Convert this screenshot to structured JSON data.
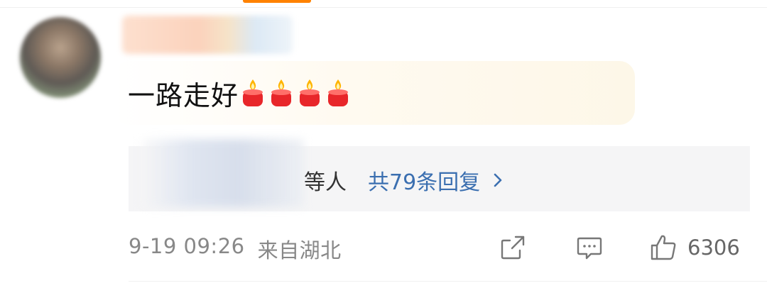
{
  "comment": {
    "text": "一路走好",
    "emoji": [
      "candle-icon",
      "candle-icon",
      "candle-icon",
      "candle-icon"
    ]
  },
  "replies": {
    "suffix": "等人",
    "count_label": "共79条回复"
  },
  "meta": {
    "time": "9-19 09:26",
    "location": "来自湖北"
  },
  "actions": {
    "like_count": "6306"
  },
  "colors": {
    "accent": "#ff8200",
    "link": "#3b6fb0",
    "candle": "#e8262a"
  }
}
